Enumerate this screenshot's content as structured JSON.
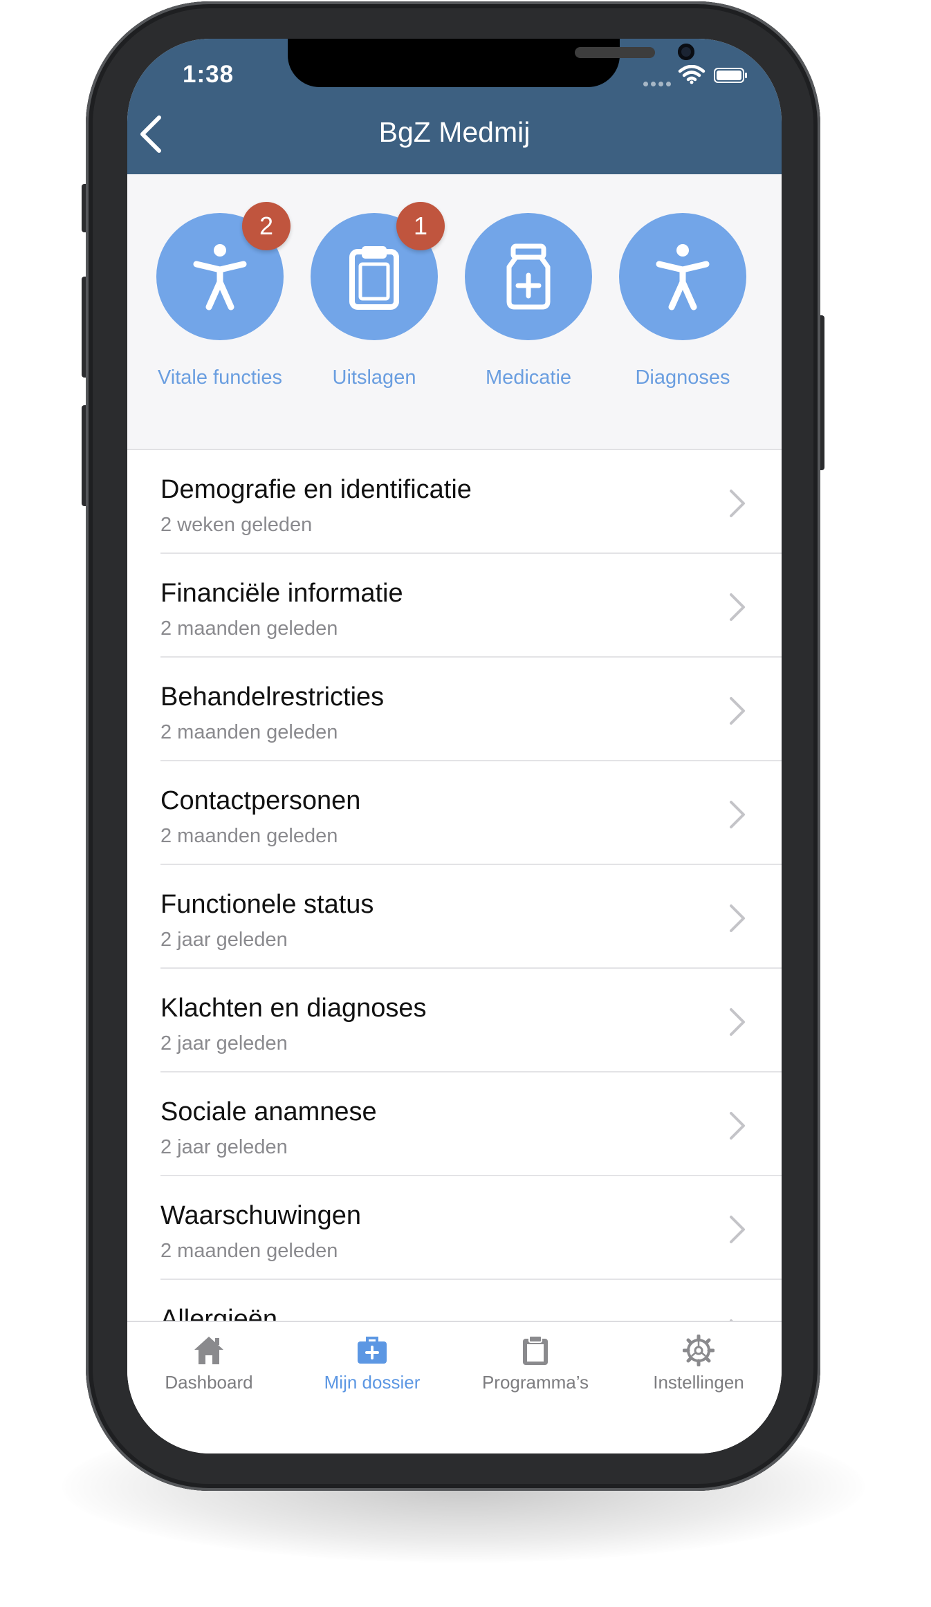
{
  "status_bar": {
    "time": "1:38"
  },
  "nav": {
    "title": "BgZ Medmij",
    "back_icon": "chevron-left-icon"
  },
  "quick_actions": [
    {
      "label": "Vitale functies",
      "icon": "person-figure-icon",
      "badge": "2"
    },
    {
      "label": "Uitslagen",
      "icon": "clipboard-icon",
      "badge": "1"
    },
    {
      "label": "Medicatie",
      "icon": "medicine-bottle-icon",
      "badge": ""
    },
    {
      "label": "Diagnoses",
      "icon": "person-figure-icon",
      "badge": ""
    }
  ],
  "list": [
    {
      "title": "Demografie en identificatie",
      "subtitle": "2 weken geleden"
    },
    {
      "title": "Financiële informatie",
      "subtitle": "2 maanden geleden"
    },
    {
      "title": "Behandelrestricties",
      "subtitle": "2 maanden geleden"
    },
    {
      "title": "Contactpersonen",
      "subtitle": "2 maanden geleden"
    },
    {
      "title": "Functionele status",
      "subtitle": "2 jaar geleden"
    },
    {
      "title": "Klachten en diagnoses",
      "subtitle": "2 jaar geleden"
    },
    {
      "title": "Sociale anamnese",
      "subtitle": "2 jaar geleden"
    },
    {
      "title": "Waarschuwingen",
      "subtitle": "2 maanden geleden"
    },
    {
      "title": "Allergieën",
      "subtitle": ""
    }
  ],
  "tabs": [
    {
      "label": "Dashboard",
      "icon": "home-icon",
      "active": false
    },
    {
      "label": "Mijn dossier",
      "icon": "medical-kit-icon",
      "active": true
    },
    {
      "label": "Programma’s",
      "icon": "clipboard-icon",
      "active": false
    },
    {
      "label": "Instellingen",
      "icon": "gear-icon",
      "active": false
    }
  ],
  "colors": {
    "header": "#3d6081",
    "accent": "#72a5e8",
    "badge": "#c0553e",
    "active_tab": "#5c97e3"
  }
}
